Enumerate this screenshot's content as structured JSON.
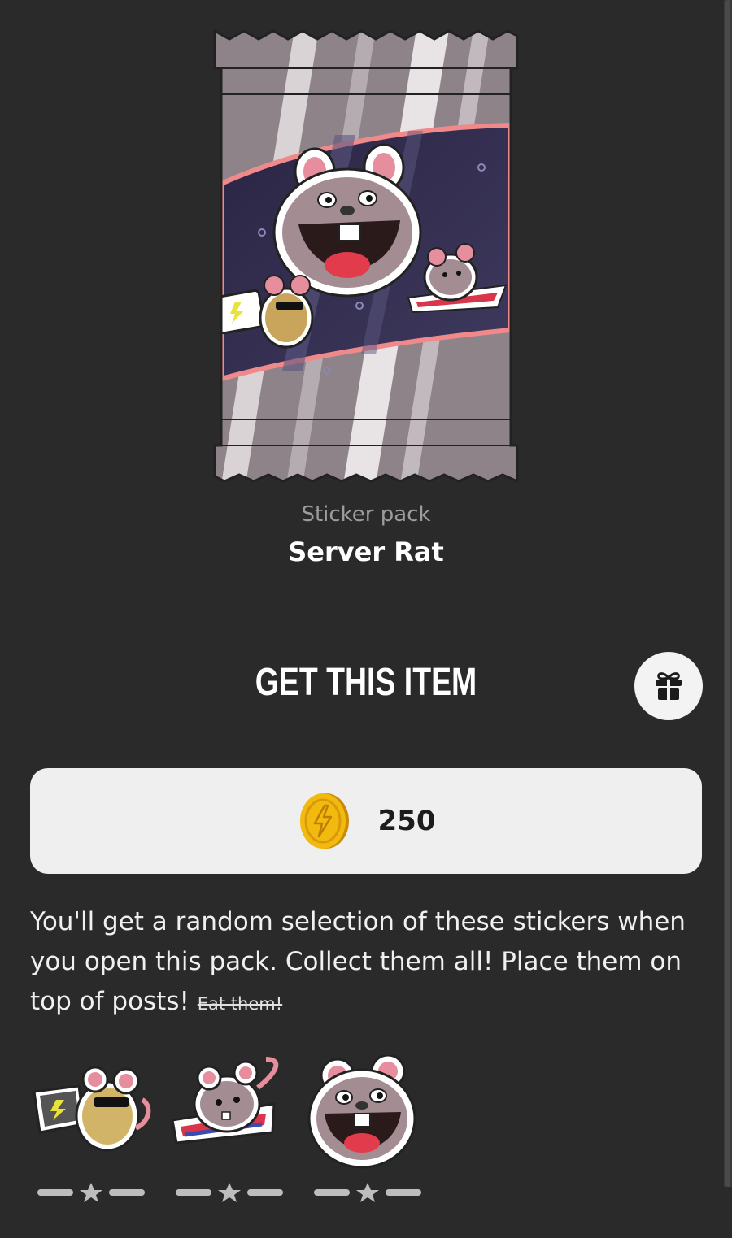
{
  "pack": {
    "kind": "Sticker pack",
    "name": "Server Rat",
    "image_icon": "server-rat-pack-icon"
  },
  "purchase": {
    "title": "GET THIS ITEM",
    "gift_icon": "gift-icon",
    "price": "250",
    "currency_icon": "coin-icon"
  },
  "description": {
    "text": "You'll get a random selection of these stickers when you open this pack. Collect them all! Place them on top of posts!",
    "struck": "Eat them!"
  },
  "stickers": [
    {
      "icon": "rat-with-laptop-sticker-icon",
      "rarity_stars": 1
    },
    {
      "icon": "flying-rat-sticker-icon",
      "rarity_stars": 1
    },
    {
      "icon": "laughing-rat-sticker-icon",
      "rarity_stars": 1
    }
  ],
  "colors": {
    "background": "#2a2a2a",
    "button": "#efefef",
    "coin": "#f2b90f"
  }
}
